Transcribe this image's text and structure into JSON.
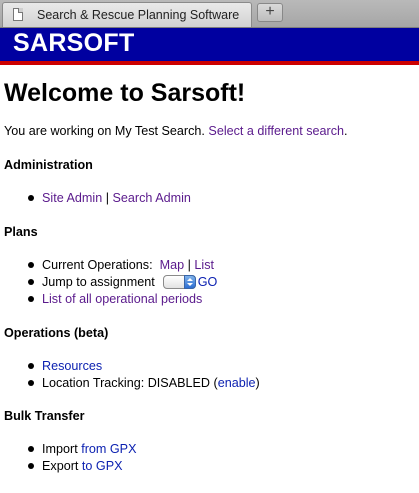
{
  "browser": {
    "tab_title": "Search & Rescue Planning Software",
    "new_tab_label": "+"
  },
  "banner": {
    "title": "SARSOFT",
    "colors": {
      "background": "#0000a0",
      "underline": "#cc0000",
      "text": "#ffffff"
    }
  },
  "page": {
    "heading": "Welcome to Sarsoft!",
    "intro_text": "You are working on My Test Search.",
    "intro_link": "Select a different search",
    "intro_end": "."
  },
  "administration": {
    "title": "Administration",
    "site_admin": "Site Admin",
    "separator": "|",
    "search_admin": "Search Admin"
  },
  "plans": {
    "title": "Plans",
    "current_ops_label": "Current Operations:",
    "map_link": "Map",
    "separator": "|",
    "list_link": "List",
    "jump_label": "Jump to assignment",
    "go_link": "GO",
    "periods_link": "List of all operational periods"
  },
  "operations": {
    "title": "Operations (beta)",
    "resources_link": "Resources",
    "tracking_label": "Location Tracking: DISABLED (",
    "enable_link": "enable",
    "tracking_end": ")"
  },
  "bulk": {
    "title": "Bulk Transfer",
    "import_label": "Import",
    "import_link": "from GPX",
    "export_label": "Export",
    "export_link": "to GPX"
  },
  "link_colors": {
    "visited": "#5a1a8c",
    "unvisited": "#0a1fb0"
  }
}
